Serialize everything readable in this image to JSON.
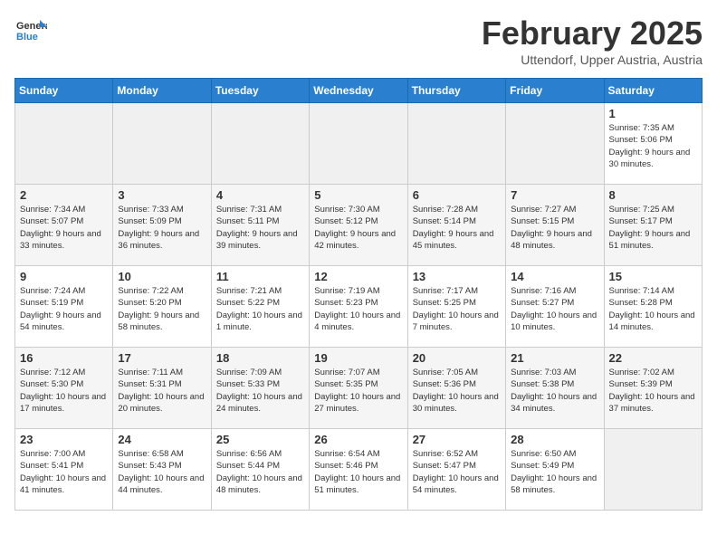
{
  "header": {
    "logo_general": "General",
    "logo_blue": "Blue",
    "month": "February 2025",
    "location": "Uttendorf, Upper Austria, Austria"
  },
  "weekdays": [
    "Sunday",
    "Monday",
    "Tuesday",
    "Wednesday",
    "Thursday",
    "Friday",
    "Saturday"
  ],
  "weeks": [
    [
      {
        "day": "",
        "info": ""
      },
      {
        "day": "",
        "info": ""
      },
      {
        "day": "",
        "info": ""
      },
      {
        "day": "",
        "info": ""
      },
      {
        "day": "",
        "info": ""
      },
      {
        "day": "",
        "info": ""
      },
      {
        "day": "1",
        "info": "Sunrise: 7:35 AM\nSunset: 5:06 PM\nDaylight: 9 hours and 30 minutes."
      }
    ],
    [
      {
        "day": "2",
        "info": "Sunrise: 7:34 AM\nSunset: 5:07 PM\nDaylight: 9 hours and 33 minutes."
      },
      {
        "day": "3",
        "info": "Sunrise: 7:33 AM\nSunset: 5:09 PM\nDaylight: 9 hours and 36 minutes."
      },
      {
        "day": "4",
        "info": "Sunrise: 7:31 AM\nSunset: 5:11 PM\nDaylight: 9 hours and 39 minutes."
      },
      {
        "day": "5",
        "info": "Sunrise: 7:30 AM\nSunset: 5:12 PM\nDaylight: 9 hours and 42 minutes."
      },
      {
        "day": "6",
        "info": "Sunrise: 7:28 AM\nSunset: 5:14 PM\nDaylight: 9 hours and 45 minutes."
      },
      {
        "day": "7",
        "info": "Sunrise: 7:27 AM\nSunset: 5:15 PM\nDaylight: 9 hours and 48 minutes."
      },
      {
        "day": "8",
        "info": "Sunrise: 7:25 AM\nSunset: 5:17 PM\nDaylight: 9 hours and 51 minutes."
      }
    ],
    [
      {
        "day": "9",
        "info": "Sunrise: 7:24 AM\nSunset: 5:19 PM\nDaylight: 9 hours and 54 minutes."
      },
      {
        "day": "10",
        "info": "Sunrise: 7:22 AM\nSunset: 5:20 PM\nDaylight: 9 hours and 58 minutes."
      },
      {
        "day": "11",
        "info": "Sunrise: 7:21 AM\nSunset: 5:22 PM\nDaylight: 10 hours and 1 minute."
      },
      {
        "day": "12",
        "info": "Sunrise: 7:19 AM\nSunset: 5:23 PM\nDaylight: 10 hours and 4 minutes."
      },
      {
        "day": "13",
        "info": "Sunrise: 7:17 AM\nSunset: 5:25 PM\nDaylight: 10 hours and 7 minutes."
      },
      {
        "day": "14",
        "info": "Sunrise: 7:16 AM\nSunset: 5:27 PM\nDaylight: 10 hours and 10 minutes."
      },
      {
        "day": "15",
        "info": "Sunrise: 7:14 AM\nSunset: 5:28 PM\nDaylight: 10 hours and 14 minutes."
      }
    ],
    [
      {
        "day": "16",
        "info": "Sunrise: 7:12 AM\nSunset: 5:30 PM\nDaylight: 10 hours and 17 minutes."
      },
      {
        "day": "17",
        "info": "Sunrise: 7:11 AM\nSunset: 5:31 PM\nDaylight: 10 hours and 20 minutes."
      },
      {
        "day": "18",
        "info": "Sunrise: 7:09 AM\nSunset: 5:33 PM\nDaylight: 10 hours and 24 minutes."
      },
      {
        "day": "19",
        "info": "Sunrise: 7:07 AM\nSunset: 5:35 PM\nDaylight: 10 hours and 27 minutes."
      },
      {
        "day": "20",
        "info": "Sunrise: 7:05 AM\nSunset: 5:36 PM\nDaylight: 10 hours and 30 minutes."
      },
      {
        "day": "21",
        "info": "Sunrise: 7:03 AM\nSunset: 5:38 PM\nDaylight: 10 hours and 34 minutes."
      },
      {
        "day": "22",
        "info": "Sunrise: 7:02 AM\nSunset: 5:39 PM\nDaylight: 10 hours and 37 minutes."
      }
    ],
    [
      {
        "day": "23",
        "info": "Sunrise: 7:00 AM\nSunset: 5:41 PM\nDaylight: 10 hours and 41 minutes."
      },
      {
        "day": "24",
        "info": "Sunrise: 6:58 AM\nSunset: 5:43 PM\nDaylight: 10 hours and 44 minutes."
      },
      {
        "day": "25",
        "info": "Sunrise: 6:56 AM\nSunset: 5:44 PM\nDaylight: 10 hours and 48 minutes."
      },
      {
        "day": "26",
        "info": "Sunrise: 6:54 AM\nSunset: 5:46 PM\nDaylight: 10 hours and 51 minutes."
      },
      {
        "day": "27",
        "info": "Sunrise: 6:52 AM\nSunset: 5:47 PM\nDaylight: 10 hours and 54 minutes."
      },
      {
        "day": "28",
        "info": "Sunrise: 6:50 AM\nSunset: 5:49 PM\nDaylight: 10 hours and 58 minutes."
      },
      {
        "day": "",
        "info": ""
      }
    ]
  ]
}
